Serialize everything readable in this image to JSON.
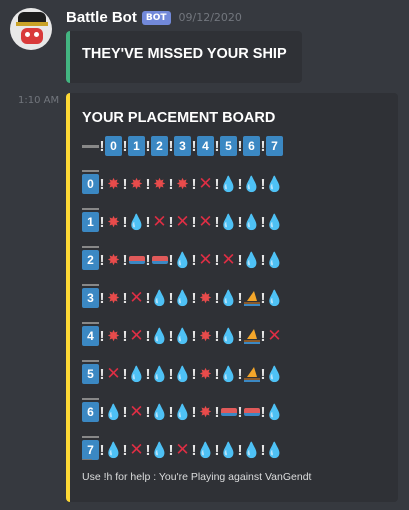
{
  "message1": {
    "username": "Battle Bot",
    "bot_tag": "BOT",
    "timestamp": "09/12/2020",
    "embed_title": "THEY'VE MISSED YOUR SHIP",
    "embed_color": "#43b581"
  },
  "message2": {
    "side_time": "1:10 AM",
    "embed_title": "YOUR PLACEMENT BOARD",
    "embed_color": "#fdd835",
    "footer": "Use !h for help : You're Playing against VanGendt"
  },
  "board": {
    "col_headers": [
      "0",
      "1",
      "2",
      "3",
      "4",
      "5",
      "6",
      "7"
    ],
    "row_headers": [
      "0",
      "1",
      "2",
      "3",
      "4",
      "5",
      "6",
      "7"
    ],
    "legend": {
      "H": "collision-icon",
      "X": "cross-mark-icon",
      "W": "droplet-icon",
      "S": "ship-icon",
      "B": "sailboat-icon"
    },
    "rows": [
      [
        "H",
        "H",
        "H",
        "H",
        "X",
        "W",
        "W",
        "W"
      ],
      [
        "H",
        "W",
        "X",
        "X",
        "X",
        "W",
        "W",
        "W"
      ],
      [
        "H",
        "S",
        "S",
        "W",
        "X",
        "X",
        "W",
        "W"
      ],
      [
        "H",
        "X",
        "W",
        "W",
        "H",
        "W",
        "B",
        "W"
      ],
      [
        "H",
        "X",
        "W",
        "W",
        "H",
        "W",
        "B",
        "X"
      ],
      [
        "X",
        "W",
        "W",
        "W",
        "H",
        "W",
        "B",
        "W"
      ],
      [
        "W",
        "X",
        "W",
        "W",
        "H",
        "S",
        "S",
        "W"
      ],
      [
        "W",
        "X",
        "W",
        "X",
        "W",
        "W",
        "W",
        "W"
      ]
    ]
  }
}
